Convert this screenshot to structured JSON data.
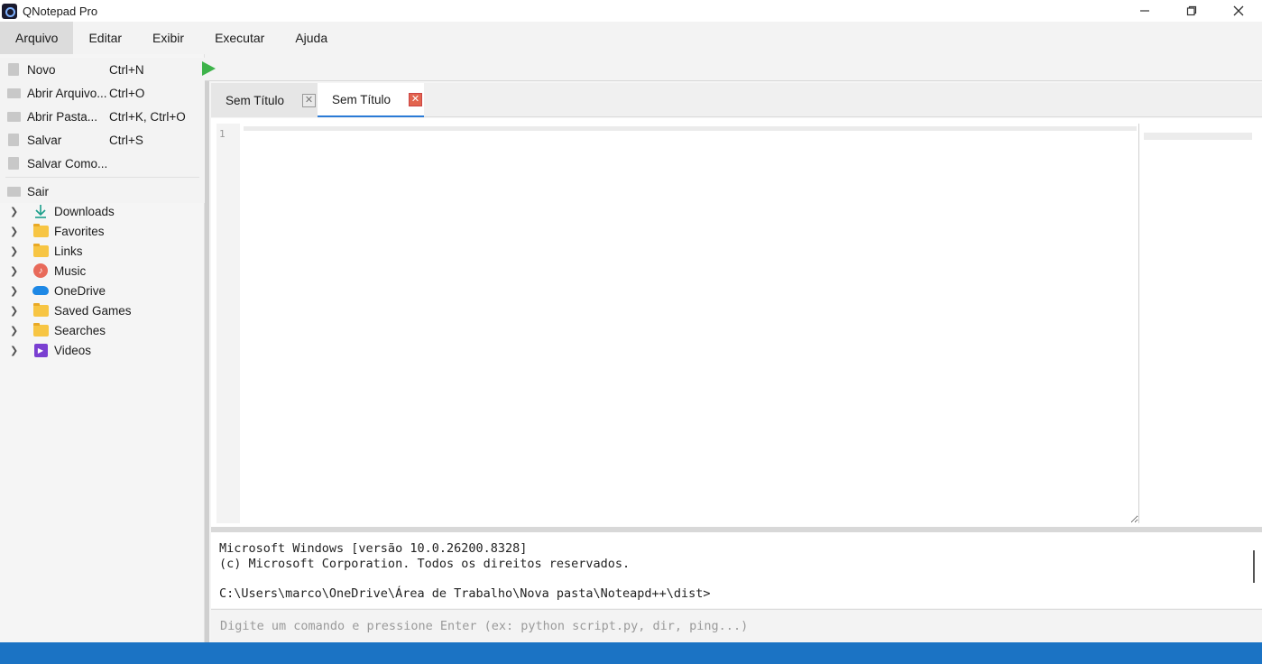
{
  "window": {
    "title": "QNotepad Pro",
    "controls": [
      "minimize-icon",
      "restore-icon",
      "close-icon"
    ]
  },
  "menubar": {
    "items": [
      {
        "label": "Arquivo",
        "active": true
      },
      {
        "label": "Editar"
      },
      {
        "label": "Exibir"
      },
      {
        "label": "Executar"
      },
      {
        "label": "Ajuda"
      }
    ]
  },
  "file_menu": {
    "items": [
      {
        "label": "Novo",
        "shortcut": "Ctrl+N",
        "icon": "new-file-icon"
      },
      {
        "label": "Abrir Arquivo...",
        "shortcut": "Ctrl+O",
        "icon": "open-folder-icon"
      },
      {
        "label": "Abrir Pasta...",
        "shortcut": "Ctrl+K, Ctrl+O",
        "icon": "open-dir-icon"
      },
      {
        "label": "Salvar",
        "shortcut": "Ctrl+S",
        "icon": "save-icon"
      },
      {
        "label": "Salvar Como...",
        "shortcut": "",
        "icon": "save-as-icon"
      },
      {
        "label": "Sair",
        "shortcut": "",
        "icon": "exit-icon"
      }
    ]
  },
  "file_tree": {
    "items": [
      {
        "label": "Downloads",
        "icon": "download-icon"
      },
      {
        "label": "Favorites",
        "icon": "folder-icon"
      },
      {
        "label": "Links",
        "icon": "folder-icon"
      },
      {
        "label": "Music",
        "icon": "music-icon"
      },
      {
        "label": "OneDrive",
        "icon": "cloud-icon"
      },
      {
        "label": "Saved Games",
        "icon": "folder-icon"
      },
      {
        "label": "Searches",
        "icon": "folder-icon"
      },
      {
        "label": "Videos",
        "icon": "video-icon"
      }
    ]
  },
  "toolbar": {
    "run_icon": "play-icon",
    "run_color": "#3db34a"
  },
  "tabs": [
    {
      "label": "Sem Título",
      "active": false
    },
    {
      "label": "Sem Título",
      "active": true
    }
  ],
  "editor": {
    "line_numbers": [
      "1"
    ],
    "content": ""
  },
  "terminal": {
    "lines": [
      "Microsoft Windows [versão 10.0.26200.8328]",
      "(c) Microsoft Corporation. Todos os direitos reservados.",
      "",
      "C:\\Users\\marco\\OneDrive\\Área de Trabalho\\Nova pasta\\Noteapd++\\dist>"
    ],
    "input_placeholder": "Digite um comando e pressione Enter (ex: python script.py, dir, ping...)",
    "input_value": ""
  },
  "colors": {
    "accent": "#1b73c4",
    "run_green": "#3db34a",
    "tab_close_active": "#e2654f"
  }
}
